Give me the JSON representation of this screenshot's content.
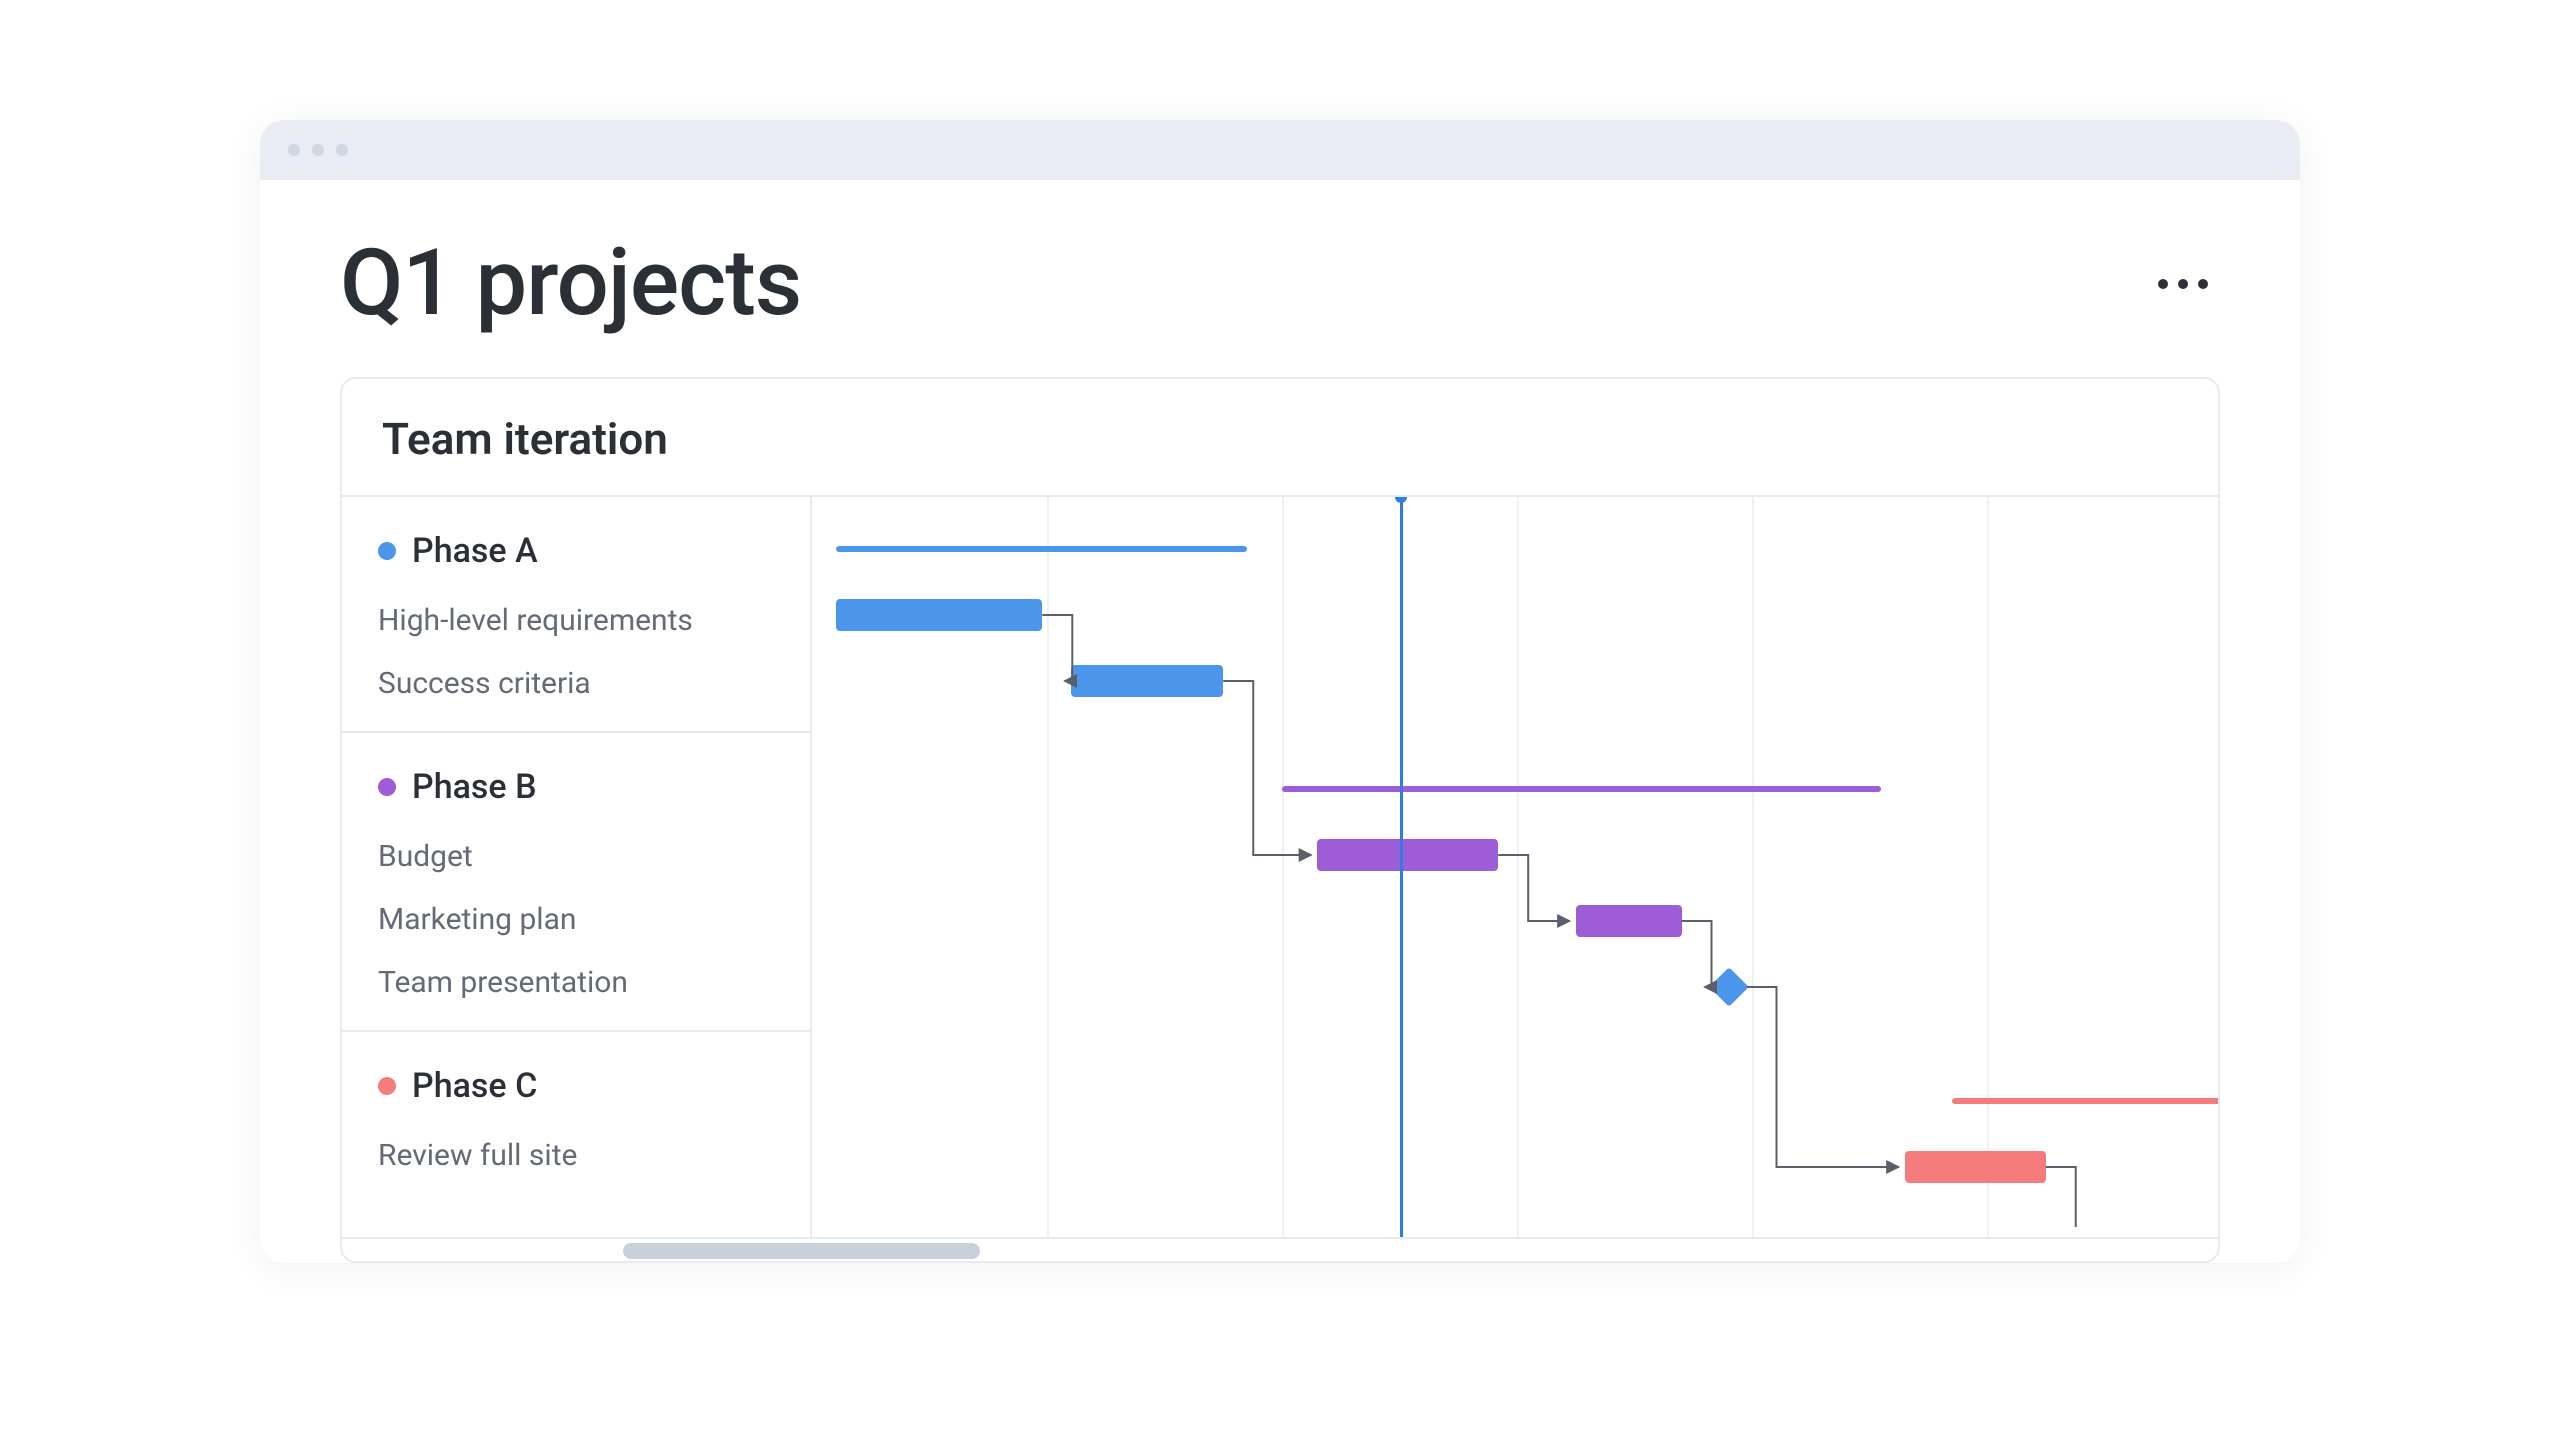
{
  "page": {
    "title": "Q1 projects",
    "panel_title": "Team iteration"
  },
  "colors": {
    "blue": "#4b96ea",
    "purple": "#9c5dd6",
    "red": "#f47c7c",
    "today": "#2f7de1"
  },
  "groups": [
    {
      "id": "a",
      "label": "Phase A",
      "color_key": "blue",
      "tasks": [
        {
          "label": "High-level requirements"
        },
        {
          "label": "Success criteria"
        }
      ]
    },
    {
      "id": "b",
      "label": "Phase B",
      "color_key": "purple",
      "tasks": [
        {
          "label": "Budget"
        },
        {
          "label": "Marketing plan"
        },
        {
          "label": "Team presentation"
        }
      ]
    },
    {
      "id": "c",
      "label": "Phase C",
      "color_key": "red",
      "tasks": [
        {
          "label": "Review full site"
        }
      ]
    }
  ],
  "chart_data": {
    "type": "gantt",
    "title": "Team iteration",
    "time_axis": {
      "columns": 6,
      "unit": "period",
      "today": 2.5
    },
    "phases": [
      {
        "name": "Phase A",
        "color": "#4b96ea",
        "start": 0.1,
        "end": 1.85
      },
      {
        "name": "Phase B",
        "color": "#9c5dd6",
        "start": 2.0,
        "end": 4.55
      },
      {
        "name": "Phase C",
        "color": "#f47c7c",
        "start": 4.85,
        "end": 6.1
      }
    ],
    "tasks": [
      {
        "group": "Phase A",
        "name": "High-level requirements",
        "start": 0.1,
        "end": 0.98,
        "color": "#4b96ea"
      },
      {
        "group": "Phase A",
        "name": "Success criteria",
        "start": 1.1,
        "end": 1.75,
        "color": "#4b96ea"
      },
      {
        "group": "Phase B",
        "name": "Budget",
        "start": 2.15,
        "end": 2.92,
        "color": "#9c5dd6"
      },
      {
        "group": "Phase B",
        "name": "Marketing plan",
        "start": 3.25,
        "end": 3.7,
        "color": "#9c5dd6"
      },
      {
        "group": "Phase B",
        "name": "Team presentation",
        "type": "milestone",
        "at": 3.9,
        "color": "#4b96ea"
      },
      {
        "group": "Phase C",
        "name": "Review full site",
        "start": 4.65,
        "end": 5.25,
        "color": "#f47c7c"
      }
    ],
    "dependencies": [
      [
        "High-level requirements",
        "Success criteria"
      ],
      [
        "Success criteria",
        "Budget"
      ],
      [
        "Budget",
        "Marketing plan"
      ],
      [
        "Marketing plan",
        "Team presentation"
      ],
      [
        "Team presentation",
        "Review full site"
      ]
    ]
  },
  "scrollbar": {
    "thumb_left_pct": 15,
    "thumb_width_pct": 19
  }
}
